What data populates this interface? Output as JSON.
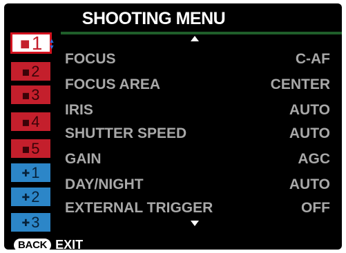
{
  "header": {
    "title": "SHOOTING MENU"
  },
  "tabs": [
    {
      "label": "1",
      "icon": "camera-icon",
      "color": "#c41f2c",
      "active": true
    },
    {
      "label": "2",
      "icon": "camera-icon",
      "color": "#c41f2c",
      "active": false
    },
    {
      "label": "3",
      "icon": "camera-icon",
      "color": "#c41f2c",
      "active": false
    },
    {
      "label": "4",
      "icon": "camera-icon",
      "color": "#c41f2c",
      "active": false
    },
    {
      "label": "5",
      "icon": "camera-icon",
      "color": "#c41f2c",
      "active": false
    },
    {
      "label": "1",
      "icon": "wrench-icon",
      "color": "#2c86c8",
      "active": false
    },
    {
      "label": "2",
      "icon": "wrench-icon",
      "color": "#2c86c8",
      "active": false
    },
    {
      "label": "3",
      "icon": "wrench-icon",
      "color": "#2c86c8",
      "active": false
    }
  ],
  "menu": {
    "items": [
      {
        "label": "FOCUS",
        "value": "C-AF"
      },
      {
        "label": "FOCUS AREA",
        "value": "CENTER"
      },
      {
        "label": "IRIS",
        "value": "AUTO"
      },
      {
        "label": "SHUTTER SPEED",
        "value": "AUTO"
      },
      {
        "label": "GAIN",
        "value": "AGC"
      },
      {
        "label": "DAY/NIGHT",
        "value": "AUTO"
      },
      {
        "label": "EXTERNAL TRIGGER",
        "value": "OFF"
      }
    ]
  },
  "footer": {
    "back_label": "BACK",
    "exit_label": "EXIT"
  },
  "colors": {
    "accent_green": "#1f5e2a",
    "menu_text": "#a8a8a8"
  }
}
